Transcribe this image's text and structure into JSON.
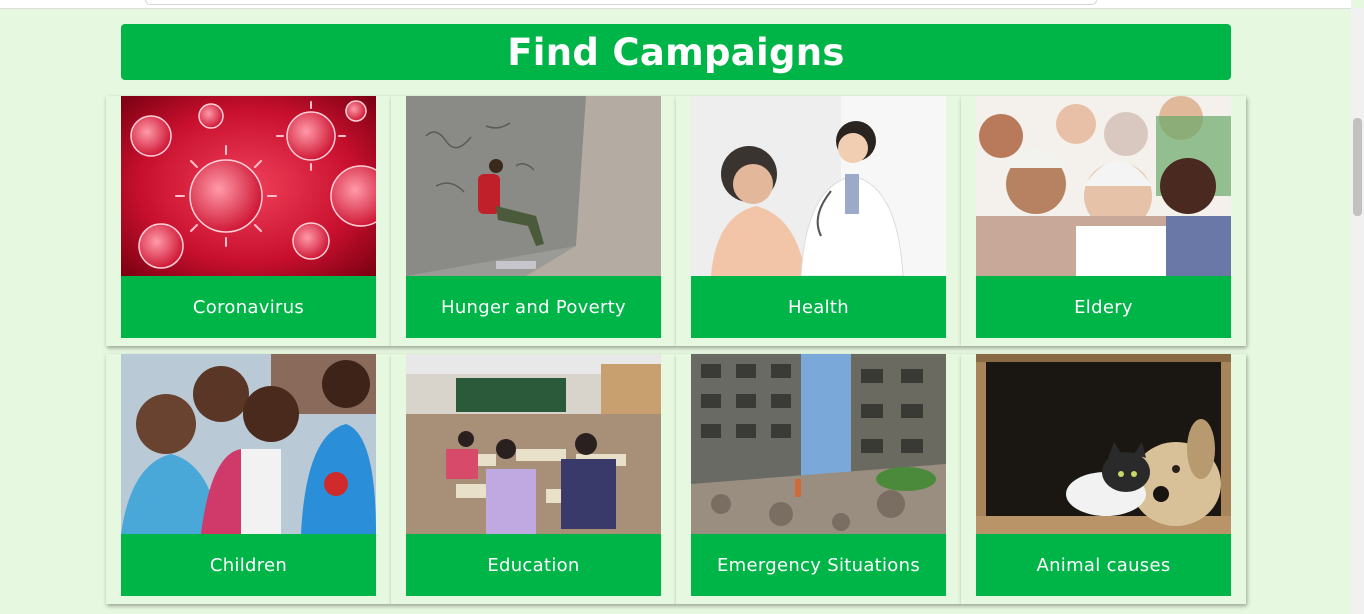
{
  "page": {
    "title": "Find Campaigns"
  },
  "colors": {
    "background": "#e6f8df",
    "accent": "#00b548",
    "label_text": "#ffffff"
  },
  "campaigns": [
    {
      "label": "Coronavirus",
      "image": "coronavirus-image"
    },
    {
      "label": "Hunger and Poverty",
      "image": "hunger-poverty-image"
    },
    {
      "label": "Health",
      "image": "health-image"
    },
    {
      "label": "Eldery",
      "image": "elderly-image"
    },
    {
      "label": "Children",
      "image": "children-image"
    },
    {
      "label": "Education",
      "image": "education-image"
    },
    {
      "label": "Emergency Situations",
      "image": "emergency-image"
    },
    {
      "label": "Animal causes",
      "image": "animal-causes-image"
    }
  ]
}
